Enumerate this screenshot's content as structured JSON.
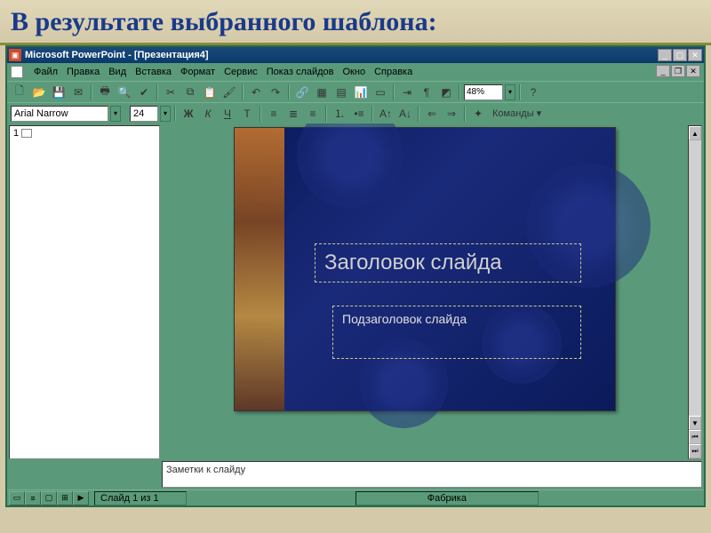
{
  "page_heading": "В результате выбранного шаблона:",
  "titlebar": {
    "app": "Microsoft PowerPoint",
    "doc": "[Презентация4]"
  },
  "menus": [
    "Файл",
    "Правка",
    "Вид",
    "Вставка",
    "Формат",
    "Сервис",
    "Показ слайдов",
    "Окно",
    "Справка"
  ],
  "toolbar1": {
    "zoom": "48%"
  },
  "toolbar2": {
    "font": "Arial Narrow",
    "size": "24",
    "commands_label": "Команды ▾"
  },
  "outline": {
    "slide_number": "1"
  },
  "slide": {
    "title_placeholder": "Заголовок слайда",
    "subtitle_placeholder": "Подзаголовок слайда"
  },
  "notes": {
    "placeholder": "Заметки к слайду"
  },
  "status": {
    "slide_info": "Слайд 1 из 1",
    "template": "Фабрика"
  }
}
